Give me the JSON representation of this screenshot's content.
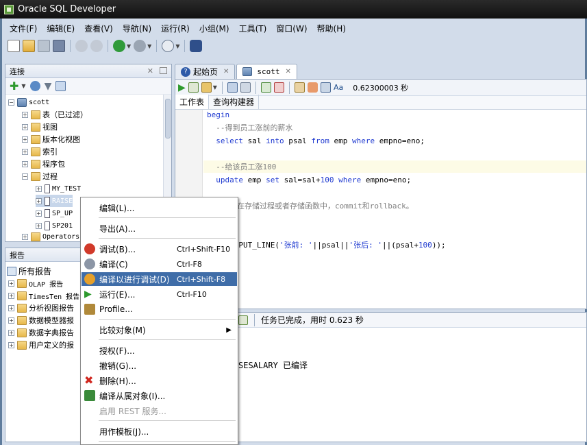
{
  "window": {
    "title": "Oracle SQL Developer"
  },
  "menubar": [
    "文件(F)",
    "编辑(E)",
    "查看(V)",
    "导航(N)",
    "运行(R)",
    "小组(M)",
    "工具(T)",
    "窗口(W)",
    "帮助(H)"
  ],
  "connections_panel": {
    "title": "连接",
    "tree": {
      "root": "scott",
      "items": [
        "表（已过滤）",
        "视图",
        "版本化视图",
        "索引",
        "程序包",
        "过程"
      ],
      "procedures": [
        "MY_TEST",
        "RAISE",
        "SP_UP",
        "SP201"
      ],
      "after": "Operators"
    }
  },
  "reports_panel": {
    "title": "报告",
    "root": "所有报告",
    "items": [
      "OLAP 报告",
      "TimesTen 报告",
      "分析视图报告",
      "数据模型器报",
      "数据字典报告",
      "用户定义的报"
    ]
  },
  "tabs": [
    {
      "label": "起始页"
    },
    {
      "label": "scott"
    }
  ],
  "editor": {
    "exec_time": "0.62300003 秒",
    "subtabs": [
      "工作表",
      "查询构建器"
    ],
    "code": {
      "l1": "begin",
      "l2": "  --得到员工涨前的薪水",
      "l3_a": "  select",
      "l3_b": " sal ",
      "l3_c": "into",
      "l3_d": " psal ",
      "l3_e": "from",
      "l3_f": " emp ",
      "l3_g": "where",
      "l3_h": " empno=eno;",
      "l5": "  --给该员工涨100",
      "l6_a": "  update",
      "l6_b": " emp ",
      "l6_c": "set",
      "l6_d": " sal=sal+",
      "l6_e": "100",
      "l6_f": " ",
      "l6_g": "where",
      "l6_h": " empno=eno;",
      "l8": "：一般不在存储过程或者存储函数中，commit和rollback。",
      "l10_a": "OUTPUT.PUT_LINE(",
      "l10_b": "'张前: '",
      "l10_c": "||psal||",
      "l10_d": "'张后: '",
      "l10_e": "||(psal+",
      "l10_f": "100",
      "l10_g": "));"
    }
  },
  "log": {
    "status": "任务已完成，用时 0.623 秒",
    "message": "SESALARY 已编译"
  },
  "context_menu": {
    "items": [
      {
        "label": "编辑(L)..."
      },
      {
        "label": "导出(A)..."
      },
      {
        "label": "调试(B)...",
        "shortcut": "Ctrl+Shift-F10"
      },
      {
        "label": "编译(C)",
        "shortcut": "Ctrl-F8"
      },
      {
        "label": "编译以进行调试(D)",
        "shortcut": "Ctrl+Shift-F8"
      },
      {
        "label": "运行(E)...",
        "shortcut": "Ctrl-F10"
      },
      {
        "label": "Profile..."
      },
      {
        "label": "比较对象(M)"
      },
      {
        "label": "授权(F)..."
      },
      {
        "label": "撤销(G)..."
      },
      {
        "label": "删除(H)..."
      },
      {
        "label": "编译从属对象(I)..."
      },
      {
        "label": "启用 REST 服务..."
      },
      {
        "label": "用作模板(J)..."
      }
    ]
  },
  "colors": {
    "selection": "#3f6da8",
    "keyword": "#1f3ad0",
    "comment": "#7f7f7f",
    "frame": "#d2dcea"
  }
}
